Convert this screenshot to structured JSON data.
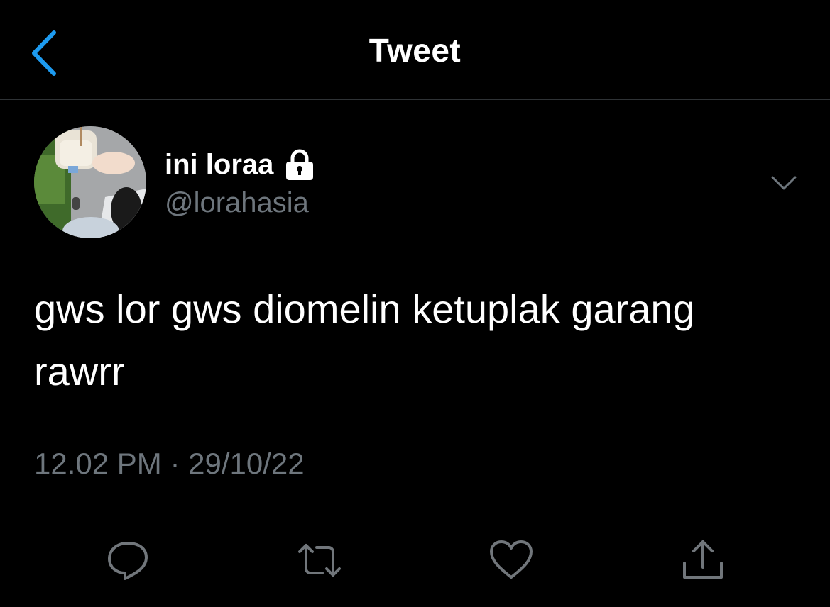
{
  "header": {
    "title": "Tweet",
    "back_icon": "chevron-left-icon"
  },
  "tweet": {
    "author": {
      "display_name": "ini loraa",
      "handle": "@lorahasia",
      "protected_icon": "lock-icon"
    },
    "text_lines": [
      "gws lor gws diomelin ketuplak garang",
      "rawrr"
    ],
    "timestamp": "12.02 PM · 29/10/22"
  },
  "actions": [
    {
      "icon": "reply-icon"
    },
    {
      "icon": "retweet-icon"
    },
    {
      "icon": "like-icon"
    },
    {
      "icon": "share-icon"
    }
  ],
  "colors": {
    "background": "#000000",
    "accent": "#1d9bf0",
    "secondary_text": "#6e767d",
    "icon": "#71767b",
    "divider": "#2f3336"
  }
}
